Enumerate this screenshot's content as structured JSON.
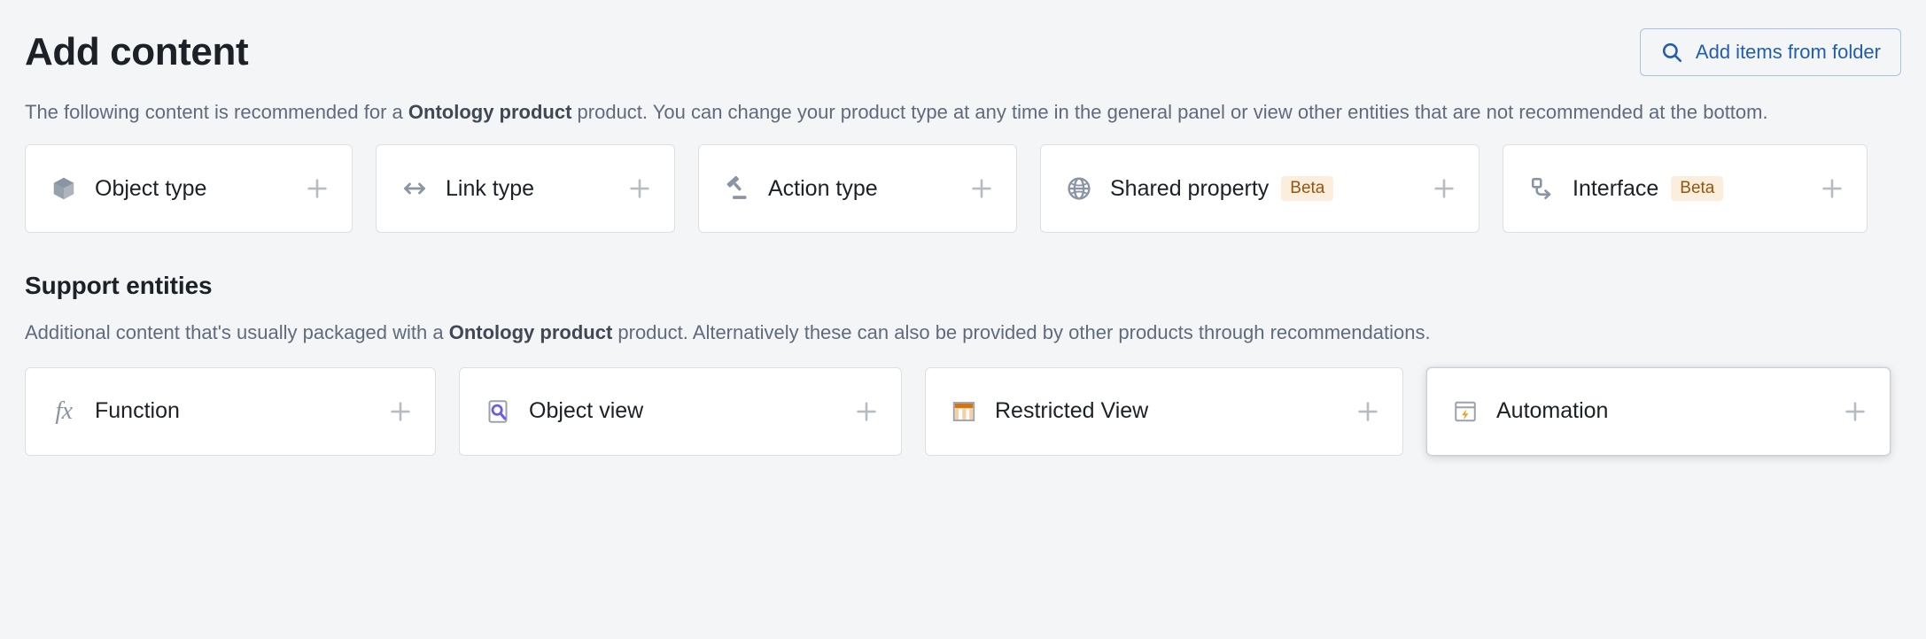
{
  "header": {
    "title": "Add content",
    "folder_button": {
      "label": "Add items from folder",
      "icon": "search-icon",
      "text_color": "#215db0",
      "border_color": "#a9c1e8"
    }
  },
  "intro": {
    "prefix": "The following content is recommended for a ",
    "product_name": "Ontology product",
    "suffix": " product. You can change your product type at any time in the general panel or view other entities that are not recommended at the bottom."
  },
  "recommended": {
    "cards": [
      {
        "label": "Object type",
        "icon": "cube-icon",
        "badge": null,
        "add_label": "+"
      },
      {
        "label": "Link type",
        "icon": "arrows-horizontal-icon",
        "badge": null,
        "add_label": "+"
      },
      {
        "label": "Action type",
        "icon": "gavel-icon",
        "badge": null,
        "add_label": "+"
      },
      {
        "label": "Shared property",
        "icon": "globe-icon",
        "badge": "Beta",
        "add_label": "+"
      },
      {
        "label": "Interface",
        "icon": "interface-node-icon",
        "badge": "Beta",
        "add_label": "+"
      }
    ]
  },
  "support": {
    "title": "Support entities",
    "description": {
      "prefix": "Additional content that's usually packaged with a ",
      "product_name": "Ontology product",
      "suffix": " product. Alternatively these can also be provided by other products through recommendations."
    },
    "cards": [
      {
        "label": "Function",
        "icon": "fx-icon",
        "badge": null,
        "add_label": "+",
        "hovered": false
      },
      {
        "label": "Object view",
        "icon": "object-view-icon",
        "badge": null,
        "add_label": "+",
        "hovered": false
      },
      {
        "label": "Restricted View",
        "icon": "restricted-view-icon",
        "badge": null,
        "add_label": "+",
        "hovered": false
      },
      {
        "label": "Automation",
        "icon": "automation-icon",
        "badge": null,
        "add_label": "+",
        "hovered": true
      }
    ]
  },
  "colors": {
    "page_background": "#f4f5f7",
    "card_background": "#ffffff",
    "card_border": "#dcdfe4",
    "heading_text": "#1c2127",
    "muted_text": "#5f6b7c",
    "badge_background": "#fbeedd",
    "badge_text": "#935610",
    "accent_blue": "#215db0",
    "icon_gray": "#8a94a2",
    "plus_gray": "#b6bcc4",
    "orange": "#d9730d",
    "purple": "#6a5cf0",
    "amber": "#f0a22e"
  }
}
